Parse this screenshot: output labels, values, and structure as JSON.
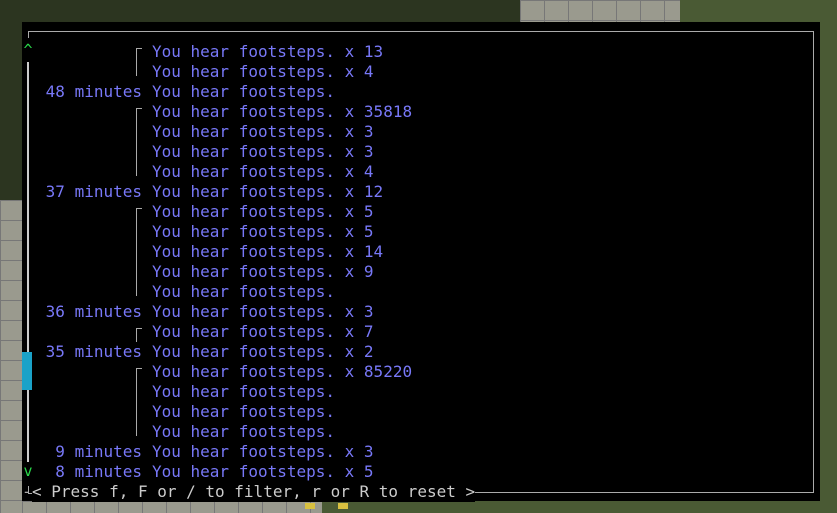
{
  "scroll": {
    "up_symbol": "^",
    "down_symbol": "v",
    "position": 0.8
  },
  "log": [
    {
      "time": "",
      "text": "You hear footsteps. x 13",
      "group": "start"
    },
    {
      "time": "",
      "text": "You hear footsteps. x 4",
      "group": "end"
    },
    {
      "time": "48 minutes",
      "text": "You hear footsteps.",
      "group": ""
    },
    {
      "time": "",
      "text": "You hear footsteps. x 35818",
      "group": "start"
    },
    {
      "time": "",
      "text": "You hear footsteps. x 3",
      "group": "mid"
    },
    {
      "time": "",
      "text": "You hear footsteps. x 3",
      "group": "mid"
    },
    {
      "time": "",
      "text": "You hear footsteps. x 4",
      "group": "end"
    },
    {
      "time": "37 minutes",
      "text": "You hear footsteps. x 12",
      "group": ""
    },
    {
      "time": "",
      "text": "You hear footsteps. x 5",
      "group": "start"
    },
    {
      "time": "",
      "text": "You hear footsteps. x 5",
      "group": "mid"
    },
    {
      "time": "",
      "text": "You hear footsteps. x 14",
      "group": "mid"
    },
    {
      "time": "",
      "text": "You hear footsteps. x 9",
      "group": "mid"
    },
    {
      "time": "",
      "text": "You hear footsteps.",
      "group": "end"
    },
    {
      "time": "36 minutes",
      "text": "You hear footsteps. x 3",
      "group": ""
    },
    {
      "time": "",
      "text": "You hear footsteps. x 7",
      "group": "start"
    },
    {
      "time": "35 minutes",
      "text": "You hear footsteps. x 2",
      "group": ""
    },
    {
      "time": "",
      "text": "You hear footsteps. x 85220",
      "group": "start"
    },
    {
      "time": "",
      "text": "You hear footsteps.",
      "group": "mid"
    },
    {
      "time": "",
      "text": "You hear footsteps.",
      "group": "mid"
    },
    {
      "time": "",
      "text": "You hear footsteps.",
      "group": "end"
    },
    {
      "time": "9 minutes",
      "text": "You hear footsteps. x 3",
      "group": ""
    },
    {
      "time": "8 minutes",
      "text": "You hear footsteps. x 5",
      "group": ""
    }
  ],
  "footer": {
    "text": "< Press f, F or / to filter, r or R to reset >"
  }
}
